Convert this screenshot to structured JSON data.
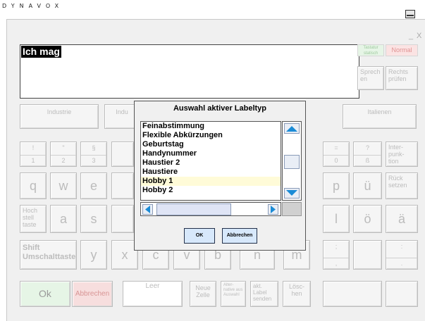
{
  "brand": "DYNAVOX",
  "window_controls": {
    "minimize": "_",
    "close": "X"
  },
  "message_text": "Ich mag",
  "top_right": {
    "tastatur_label": "Tastatur statisch",
    "mode": "Normal",
    "speak": "Sprech en",
    "spellcheck": "Rechts prüfen"
  },
  "label_row": [
    "Industrie",
    "Indu",
    "Italienen"
  ],
  "numbers_row": [
    {
      "top": "!",
      "bottom": "1"
    },
    {
      "top": "\"",
      "bottom": "2"
    },
    {
      "top": "§",
      "bottom": "3"
    },
    {
      "top": "=",
      "bottom": "0"
    },
    {
      "top": "?",
      "bottom": "ß"
    }
  ],
  "interpunktion": "Inter- punk- tion",
  "row_q": [
    "q",
    "w",
    "e",
    "p",
    "ü"
  ],
  "backspace": "Rück setzen",
  "row_a": [
    "a",
    "s",
    "l",
    "ö",
    "ä"
  ],
  "hoch": "Hoch stell taste",
  "row_y": [
    "y",
    "x",
    "c",
    "v",
    "b",
    "n",
    "m"
  ],
  "shift": "Shift Umschalttaste",
  "semicolon": {
    "top": ";",
    "bottom": ","
  },
  "colon": {
    "top": ":",
    "bottom": "."
  },
  "bottom_row": {
    "ok": "Ok",
    "cancel": "Abbrechen",
    "space": "Leer",
    "new_cell": "Neue Zelle",
    "alternatives": "Alter- native aus Auswahl",
    "send_label": "akt. Label senden",
    "delete": "Lösc- hen"
  },
  "dialog": {
    "title": "Auswahl aktiver Labeltyp",
    "items": [
      "Feinabstimmung",
      "Flexible Abkürzungen",
      "Geburtstag",
      "Handynummer",
      "Haustier 2",
      "Haustiere",
      "Hobby 1",
      "Hobby 2"
    ],
    "selected": "Hobby 1",
    "ok": "OK",
    "cancel": "Abbrechen"
  },
  "colors": {
    "accent_blue": "#1a8bd6",
    "ok_green": "#e6f5e6",
    "cancel_red": "#f7dede",
    "list_highlight": "#fffbd8"
  }
}
